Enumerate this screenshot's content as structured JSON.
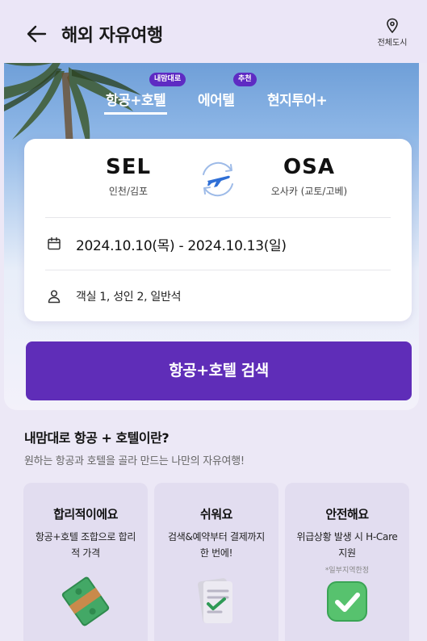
{
  "header": {
    "title": "해외 자유여행",
    "city_button_label": "전체도시",
    "back_icon": "arrow-left-icon",
    "city_icon": "map-pin-icon"
  },
  "tabs": [
    {
      "label": "항공+호텔",
      "badge": "내맘대로",
      "active": true
    },
    {
      "label": "에어텔",
      "badge": "추천",
      "active": false
    },
    {
      "label": "현지투어+",
      "badge": "",
      "active": false
    }
  ],
  "search": {
    "origin": {
      "code": "SEL",
      "name": "인천/김포"
    },
    "destination": {
      "code": "OSA",
      "name": "오사카 (교토/고베)"
    },
    "dates": "2024.10.10(목) - 2024.10.13(일)",
    "rooms": "객실 1, 성인 2, 일반석",
    "button_label": "항공+호텔 검색"
  },
  "info": {
    "title": "내맘대로 항공 + 호텔이란?",
    "subtitle": "원하는 항공과 호텔을 골라 만드는 나만의 자유여행!",
    "features": [
      {
        "title": "합리적이에요",
        "desc": "항공+호텔 조합으로 합리적 가격",
        "note": "",
        "icon": "money-stack-icon"
      },
      {
        "title": "쉬워요",
        "desc": "검색&예약부터 결제까지 한 번에!",
        "note": "",
        "icon": "receipt-check-icon"
      },
      {
        "title": "안전해요",
        "desc": "위급상황 발생 시 H-Care 지원",
        "note": "*일부지역한정",
        "icon": "check-badge-icon"
      }
    ]
  },
  "colors": {
    "brand": "#5f2db8",
    "badge": "#5e2bc3",
    "background": "#ece8f6",
    "feature_card": "#e2ddf0"
  }
}
